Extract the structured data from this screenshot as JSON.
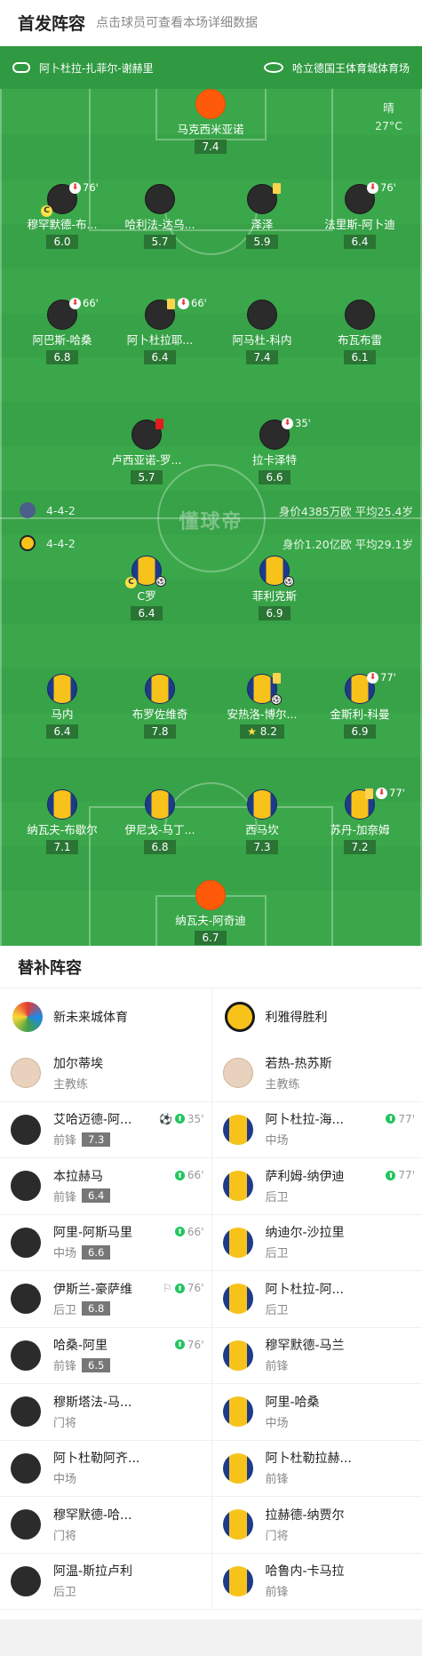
{
  "header": {
    "title": "首发阵容",
    "subtitle": "点击球员可查看本场详细数据"
  },
  "pitch": {
    "coach_home": "阿卜杜拉-扎菲尔-谢赫里",
    "stadium": "哈立德国王体育城体育场",
    "weather": "晴",
    "temperature": "27°C",
    "watermark": "懂球帝",
    "home": {
      "formation": "4-4-2",
      "value_avg": "身价4385万欧  平均25.4岁"
    },
    "away": {
      "formation": "4-4-2",
      "value_avg": "身价1.20亿欧  平均29.1岁"
    }
  },
  "players": [
    {
      "name": "马克西米亚诺",
      "rating": "7.4"
    },
    {
      "name": "穆罕默德-布...",
      "rating": "6.0",
      "sub": "76'"
    },
    {
      "name": "哈利法-达乌...",
      "rating": "5.7"
    },
    {
      "name": "泽泽",
      "rating": "5.9"
    },
    {
      "name": "法里斯-阿卜迪",
      "rating": "6.4",
      "sub": "76'"
    },
    {
      "name": "阿巴斯-哈桑",
      "rating": "6.8",
      "sub": "66'"
    },
    {
      "name": "阿卜杜拉耶...",
      "rating": "6.4",
      "sub": "66'"
    },
    {
      "name": "阿马杜-科内",
      "rating": "7.4"
    },
    {
      "name": "布瓦布雷",
      "rating": "6.1"
    },
    {
      "name": "卢西亚诺-罗...",
      "rating": "5.7"
    },
    {
      "name": "拉卡泽特",
      "rating": "6.6",
      "sub": "35'"
    },
    {
      "name": "C罗",
      "rating": "6.4"
    },
    {
      "name": "菲利克斯",
      "rating": "6.9"
    },
    {
      "name": "马内",
      "rating": "6.4"
    },
    {
      "name": "布罗佐维奇",
      "rating": "7.8"
    },
    {
      "name": "安热洛-博尔...",
      "rating": "8.2"
    },
    {
      "name": "金斯利-科曼",
      "rating": "6.9",
      "sub": "77'"
    },
    {
      "name": "纳瓦夫-布歇尔",
      "rating": "7.1"
    },
    {
      "name": "伊尼戈-马丁...",
      "rating": "6.8"
    },
    {
      "name": "西马坎",
      "rating": "7.3"
    },
    {
      "name": "苏丹-加奈姆",
      "rating": "7.2",
      "sub": "77'"
    },
    {
      "name": "纳瓦夫-阿奇迪",
      "rating": "6.7"
    }
  ],
  "bench": {
    "title": "替补阵容",
    "home": {
      "team": "新未来城体育",
      "coach": {
        "name": "加尔蒂埃",
        "role": "主教练"
      },
      "subs": [
        {
          "name": "艾哈迈德-阿...",
          "pos": "前锋",
          "rating": "7.3",
          "evt": "35'"
        },
        {
          "name": "本拉赫马",
          "pos": "前锋",
          "rating": "6.4",
          "evt": "66'"
        },
        {
          "name": "阿里-阿斯马里",
          "pos": "中场",
          "rating": "6.6",
          "evt": "66'"
        },
        {
          "name": "伊斯兰-豪萨维",
          "pos": "后卫",
          "rating": "6.8",
          "evt": "76'"
        },
        {
          "name": "哈桑-阿里",
          "pos": "前锋",
          "rating": "6.5",
          "evt": "76'"
        },
        {
          "name": "穆斯塔法-马...",
          "pos": "门将"
        },
        {
          "name": "阿卜杜勒阿齐...",
          "pos": "中场"
        },
        {
          "name": "穆罕默德-哈...",
          "pos": "门将"
        },
        {
          "name": "阿温-斯拉卢利",
          "pos": "后卫"
        }
      ]
    },
    "away": {
      "team": "利雅得胜利",
      "coach": {
        "name": "若热-热苏斯",
        "role": "主教练"
      },
      "subs": [
        {
          "name": "阿卜杜拉-海...",
          "pos": "中场",
          "evt": "77'"
        },
        {
          "name": "萨利姆-纳伊迪",
          "pos": "后卫",
          "evt": "77'"
        },
        {
          "name": "纳迪尔-沙拉里",
          "pos": "后卫"
        },
        {
          "name": "阿卜杜拉-阿...",
          "pos": "后卫"
        },
        {
          "name": "穆罕默德-马兰",
          "pos": "前锋"
        },
        {
          "name": "阿里-哈桑",
          "pos": "中场"
        },
        {
          "name": "阿卜杜勒拉赫...",
          "pos": "前锋"
        },
        {
          "name": "拉赫德-纳贾尔",
          "pos": "门将"
        },
        {
          "name": "哈鲁内-卡马拉",
          "pos": "前锋"
        }
      ]
    }
  }
}
